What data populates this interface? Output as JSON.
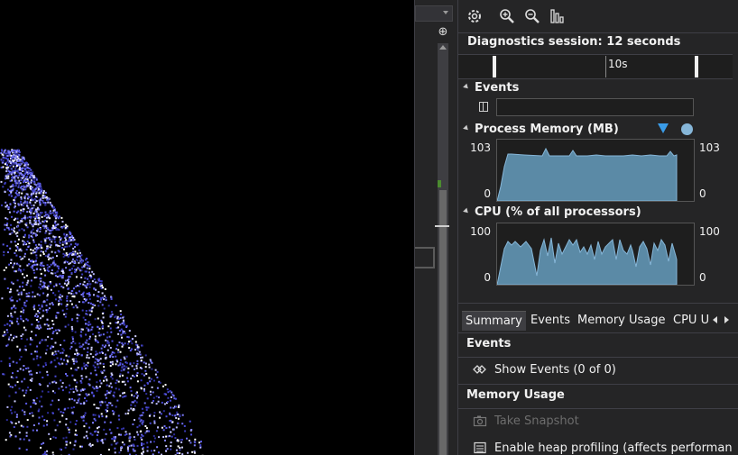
{
  "diagnostics": {
    "session_label": "Diagnostics session: 12 seconds",
    "ruler_label": "10s",
    "events_section": "Events",
    "memory_section": "Process Memory (MB)",
    "memory_max_left": "103",
    "memory_min_left": "0",
    "memory_max_right": "103",
    "memory_min_right": "0",
    "cpu_section": "CPU (% of all processors)",
    "cpu_max_left": "100",
    "cpu_min_left": "0",
    "cpu_max_right": "100",
    "cpu_min_right": "0",
    "tabs": [
      "Summary",
      "Events",
      "Memory Usage",
      "CPU U"
    ],
    "summary": {
      "events_header": "Events",
      "show_events": "Show Events (0 of 0)",
      "memory_header": "Memory Usage",
      "take_snapshot": "Take Snapshot",
      "heap_profiling": "Enable heap profiling (affects performan"
    }
  },
  "colors": {
    "chart_fill": "#5b8aa6",
    "chart_stroke": "#86b6d8",
    "snapshot_marker": "#3a9ce8",
    "gc_marker": "#86b6d8",
    "particle": "#4a4ad8"
  },
  "icons": {
    "toolbar": [
      "gear-icon",
      "zoom-in-icon",
      "zoom-out-icon",
      "reset-zoom-icon"
    ]
  }
}
